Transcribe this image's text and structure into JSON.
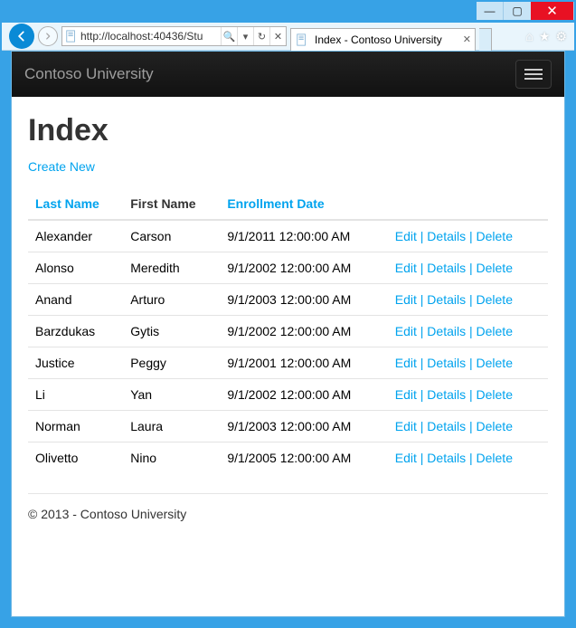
{
  "window": {
    "min_glyph": "—",
    "max_glyph": "▢",
    "close_glyph": "✕"
  },
  "toolbar": {
    "url": "http://localhost:40436/Stu",
    "search_glyph": "🔍",
    "dropdown_glyph": "▾",
    "refresh_glyph": "↻",
    "stop_glyph": "✕"
  },
  "tab": {
    "title": "Index - Contoso University",
    "close_glyph": "✕"
  },
  "chrome_icons": {
    "home": "⌂",
    "favorites": "★",
    "tools": "⚙"
  },
  "navbar": {
    "brand": "Contoso University"
  },
  "page": {
    "title": "Index",
    "create_label": "Create New"
  },
  "table": {
    "headers": {
      "last_name": "Last Name",
      "first_name": "First Name",
      "enrollment_date": "Enrollment Date"
    },
    "actions": {
      "edit": "Edit",
      "details": "Details",
      "delete": "Delete"
    },
    "rows": [
      {
        "last": "Alexander",
        "first": "Carson",
        "date": "9/1/2011 12:00:00 AM"
      },
      {
        "last": "Alonso",
        "first": "Meredith",
        "date": "9/1/2002 12:00:00 AM"
      },
      {
        "last": "Anand",
        "first": "Arturo",
        "date": "9/1/2003 12:00:00 AM"
      },
      {
        "last": "Barzdukas",
        "first": "Gytis",
        "date": "9/1/2002 12:00:00 AM"
      },
      {
        "last": "Justice",
        "first": "Peggy",
        "date": "9/1/2001 12:00:00 AM"
      },
      {
        "last": "Li",
        "first": "Yan",
        "date": "9/1/2002 12:00:00 AM"
      },
      {
        "last": "Norman",
        "first": "Laura",
        "date": "9/1/2003 12:00:00 AM"
      },
      {
        "last": "Olivetto",
        "first": "Nino",
        "date": "9/1/2005 12:00:00 AM"
      }
    ]
  },
  "footer": {
    "text": "© 2013 - Contoso University"
  }
}
